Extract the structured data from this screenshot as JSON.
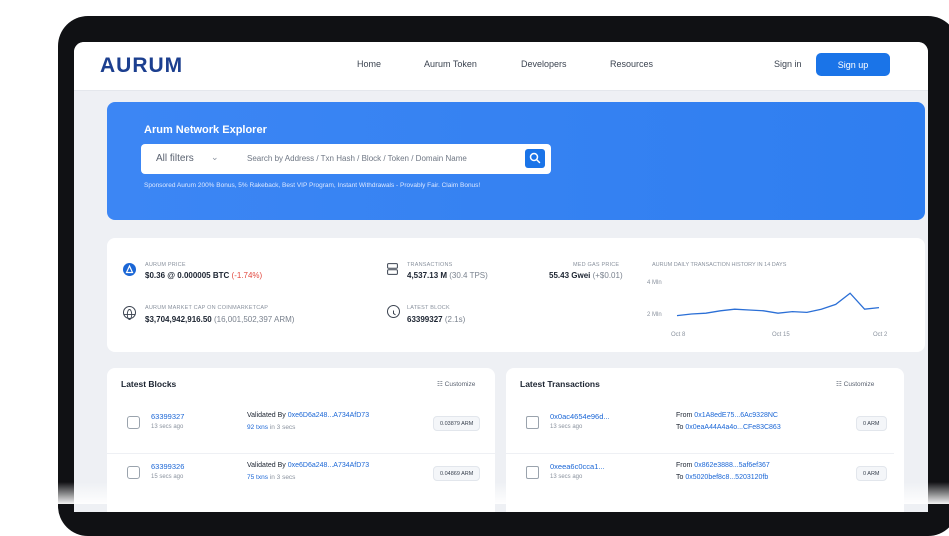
{
  "nav": {
    "logo": "AURUM",
    "links": [
      "Home",
      "Aurum Token",
      "Developers",
      "Resources"
    ],
    "sign_in": "Sign in",
    "sign_up": "Sign up"
  },
  "hero": {
    "title": "Arum Network Explorer",
    "filter_label": "All filters",
    "search_placeholder": "Search by Address / Txn Hash / Block / Token / Domain Name",
    "sponsored": "Sponsored Aurum 200% Bonus, 5% Rakeback, Best VIP Program, Instant Withdrawals - Provably Fair. Claim Bonus!"
  },
  "stats": {
    "aurum_price": {
      "label": "AURUM PRICE",
      "value": "$0.36 @ 0.000005 BTC",
      "change": "(-1.74%)"
    },
    "market_cap": {
      "label": "AURUM MARKET CAP ON COINMARKETCAP",
      "value": "$3,704,942,916.50",
      "sub": "(16,001,502,397 ARM)"
    },
    "transactions": {
      "label": "TRANSACTIONS",
      "value": "4,537.13 M",
      "sub": "(30.4 TPS)"
    },
    "latest_block": {
      "label": "LATEST BLOCK",
      "value": "63399327",
      "sub": "(2.1s)"
    },
    "med_gas": {
      "label": "MED GAS PRICE",
      "value": "55.43 Gwei",
      "sub": "(+$0.01)"
    },
    "chart": {
      "label": "AURUM DAILY TRANSACTION HISTORY IN 14 DAYS",
      "y_ticks": [
        "4 Mln",
        "2 Mln"
      ],
      "x_ticks": [
        "Oct 8",
        "Oct 15",
        "Oct 22"
      ]
    }
  },
  "chart_data": {
    "type": "line",
    "title": "AURUM DAILY TRANSACTION HISTORY IN 14 DAYS",
    "x": [
      "Oct 8",
      "Oct 9",
      "Oct 10",
      "Oct 11",
      "Oct 12",
      "Oct 13",
      "Oct 14",
      "Oct 15",
      "Oct 16",
      "Oct 17",
      "Oct 18",
      "Oct 19",
      "Oct 20",
      "Oct 21",
      "Oct 22"
    ],
    "series": [
      {
        "values": [
          1.9,
          2.0,
          2.05,
          2.2,
          2.3,
          2.25,
          2.2,
          2.05,
          2.15,
          2.1,
          2.3,
          2.6,
          3.3,
          2.3,
          2.4
        ]
      }
    ],
    "ylim": [
      1.5,
      4.5
    ],
    "yticks": [
      2,
      4
    ]
  },
  "latest_blocks": {
    "title": "Latest Blocks",
    "customize": "Customize",
    "rows": [
      {
        "id": "63399327",
        "age": "13 secs ago",
        "validated_prefix": "Validated By",
        "validator": "0xe6D6a248...A734AfD73",
        "txns": "92 txns",
        "txns_suffix": "in 3 secs",
        "amount": "0.03879 ARM"
      },
      {
        "id": "63399326",
        "age": "15 secs ago",
        "validated_prefix": "Validated By",
        "validator": "0xe6D6a248...A734AfD73",
        "txns": "75 txns",
        "txns_suffix": "in 3 secs",
        "amount": "0.04869 ARM"
      }
    ]
  },
  "latest_transactions": {
    "title": "Latest Transactions",
    "customize": "Customize",
    "rows": [
      {
        "hash": "0x0ac4654e96d...",
        "age": "13 secs ago",
        "from_prefix": "From",
        "from": "0x1A8edE75...6Ac9328NC",
        "to_prefix": "To",
        "to": "0x0eaA44A4a4o...CFe83C863",
        "amount": "0 ARM"
      },
      {
        "hash": "0xeea6c0cca1...",
        "age": "13 secs ago",
        "from_prefix": "From",
        "from": "0x862e3888...5af6ef367",
        "to_prefix": "To",
        "to": "0x5020bef8c8...5203120fb",
        "amount": "0 ARM"
      }
    ]
  },
  "colors": {
    "brand": "#1c3f8f",
    "accent": "#1a74e8",
    "hero": "#3c86f4",
    "link": "#1a66d6",
    "negative": "#e1483f"
  }
}
